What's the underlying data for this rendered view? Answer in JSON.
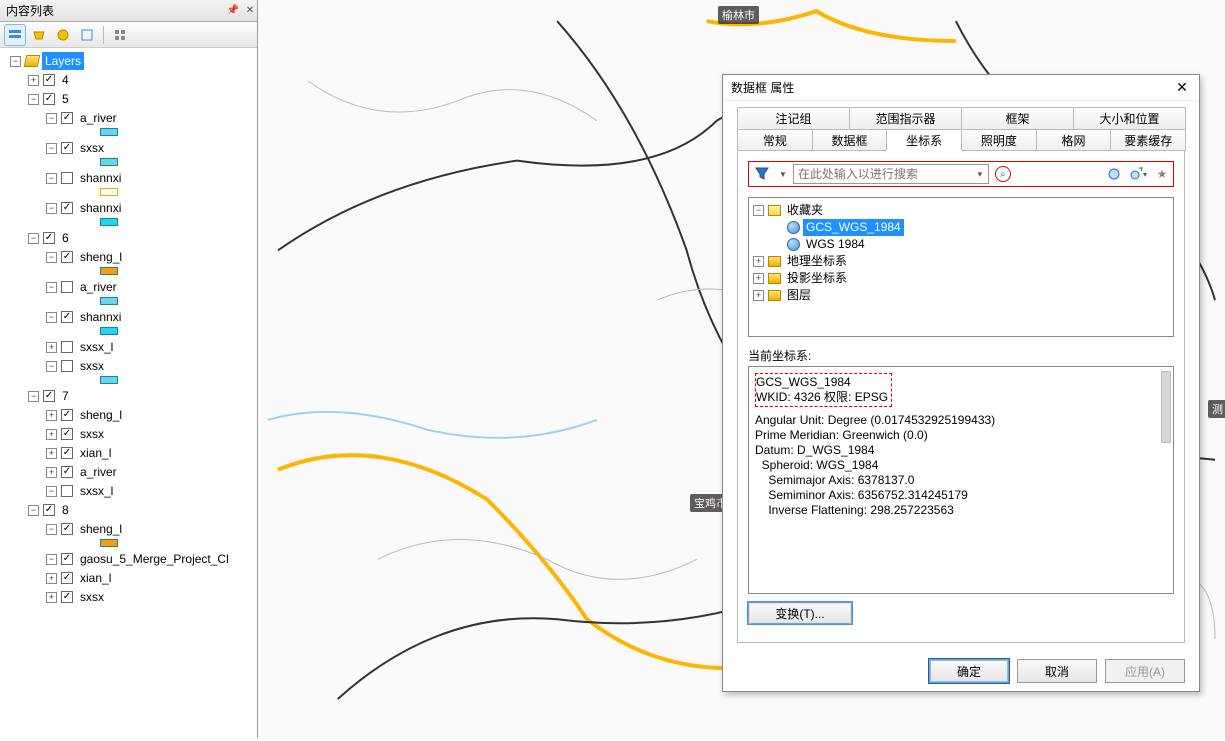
{
  "toc": {
    "title": "内容列表",
    "root": "Layers",
    "nodes": [
      {
        "indent": 0,
        "exp": "-",
        "check": null,
        "icon": "layers",
        "label": "Layers",
        "selected": true
      },
      {
        "indent": 1,
        "exp": "+",
        "check": true,
        "icon": null,
        "label": "4"
      },
      {
        "indent": 1,
        "exp": "-",
        "check": true,
        "icon": null,
        "label": "5"
      },
      {
        "indent": 2,
        "exp": "-",
        "check": true,
        "icon": null,
        "label": "a_river"
      },
      {
        "indent": 3,
        "swatch": "#6fd3e8"
      },
      {
        "indent": 2,
        "exp": "-",
        "check": true,
        "icon": null,
        "label": "sxsx"
      },
      {
        "indent": 3,
        "swatch": "#6fd3e8"
      },
      {
        "indent": 2,
        "exp": "-",
        "check": false,
        "icon": null,
        "label": "shannxi"
      },
      {
        "indent": 3,
        "swatch_outline": "#e8b100"
      },
      {
        "indent": 2,
        "exp": "-",
        "check": true,
        "icon": null,
        "label": "shannxi"
      },
      {
        "indent": 3,
        "swatch": "#29d3e8"
      },
      {
        "indent": 1,
        "exp": "-",
        "check": true,
        "icon": null,
        "label": "6"
      },
      {
        "indent": 2,
        "exp": "-",
        "check": true,
        "icon": null,
        "label": "sheng_l"
      },
      {
        "indent": 3,
        "swatch": "#ff9e00"
      },
      {
        "indent": 2,
        "exp": "-",
        "check": false,
        "icon": null,
        "label": "a_river"
      },
      {
        "indent": 3,
        "swatch": "#6fd3e8"
      },
      {
        "indent": 2,
        "exp": "-",
        "check": true,
        "icon": null,
        "label": "shannxi"
      },
      {
        "indent": 3,
        "swatch": "#29d3e8"
      },
      {
        "indent": 2,
        "exp": "+",
        "check": false,
        "icon": null,
        "label": "sxsx_l"
      },
      {
        "indent": 2,
        "exp": "-",
        "check": false,
        "icon": null,
        "label": "sxsx"
      },
      {
        "indent": 3,
        "swatch": "#6fd3e8"
      },
      {
        "indent": 1,
        "exp": "-",
        "check": true,
        "icon": null,
        "label": "7"
      },
      {
        "indent": 2,
        "exp": "+",
        "check": true,
        "icon": null,
        "label": "sheng_l"
      },
      {
        "indent": 2,
        "exp": "+",
        "check": true,
        "icon": null,
        "label": "sxsx"
      },
      {
        "indent": 2,
        "exp": "+",
        "check": true,
        "icon": null,
        "label": "xian_l"
      },
      {
        "indent": 2,
        "exp": "+",
        "check": true,
        "icon": null,
        "label": "a_river"
      },
      {
        "indent": 2,
        "exp": "-",
        "check": false,
        "icon": null,
        "label": "sxsx_l"
      },
      {
        "indent": 1,
        "exp": "-",
        "check": true,
        "icon": null,
        "label": "8"
      },
      {
        "indent": 2,
        "exp": "-",
        "check": true,
        "icon": null,
        "label": "sheng_l"
      },
      {
        "indent": 3,
        "swatch": "#ff9e00"
      },
      {
        "indent": 2,
        "exp": "-",
        "check": true,
        "icon": null,
        "label": "gaosu_5_Merge_Project_Cl"
      },
      {
        "indent": 2,
        "exp": "+",
        "check": true,
        "icon": null,
        "label": "xian_l"
      },
      {
        "indent": 2,
        "exp": "+",
        "check": true,
        "icon": null,
        "label": "sxsx"
      }
    ]
  },
  "map_labels": {
    "yulin": "榆林市",
    "baoji": "宝鸡市",
    "ce": "测"
  },
  "dialog": {
    "title": "数据框 属性",
    "tabs_row1": [
      "注记组",
      "范围指示器",
      "框架",
      "大小和位置"
    ],
    "tabs_row2": [
      "常规",
      "数据框",
      "坐标系",
      "照明度",
      "格网",
      "要素缓存"
    ],
    "active_tab": "坐标系",
    "search_placeholder": "在此处输入以进行搜索",
    "fav_folder": "收藏夹",
    "fav_items": [
      "GCS_WGS_1984",
      "WGS 1984"
    ],
    "folders": [
      "地理坐标系",
      "投影坐标系",
      "图层"
    ],
    "current_cs_label": "当前坐标系:",
    "details_line1": "GCS_WGS_1984",
    "details_line2": "WKID: 4326 权限: EPSG",
    "details_rest": [
      "Angular Unit: Degree (0.0174532925199433)",
      "Prime Meridian: Greenwich (0.0)",
      "Datum: D_WGS_1984",
      "  Spheroid: WGS_1984",
      "    Semimajor Axis: 6378137.0",
      "    Semiminor Axis: 6356752.314245179",
      "    Inverse Flattening: 298.257223563"
    ],
    "transform_btn": "变换(T)...",
    "ok": "确定",
    "cancel": "取消",
    "apply": "应用(A)"
  }
}
